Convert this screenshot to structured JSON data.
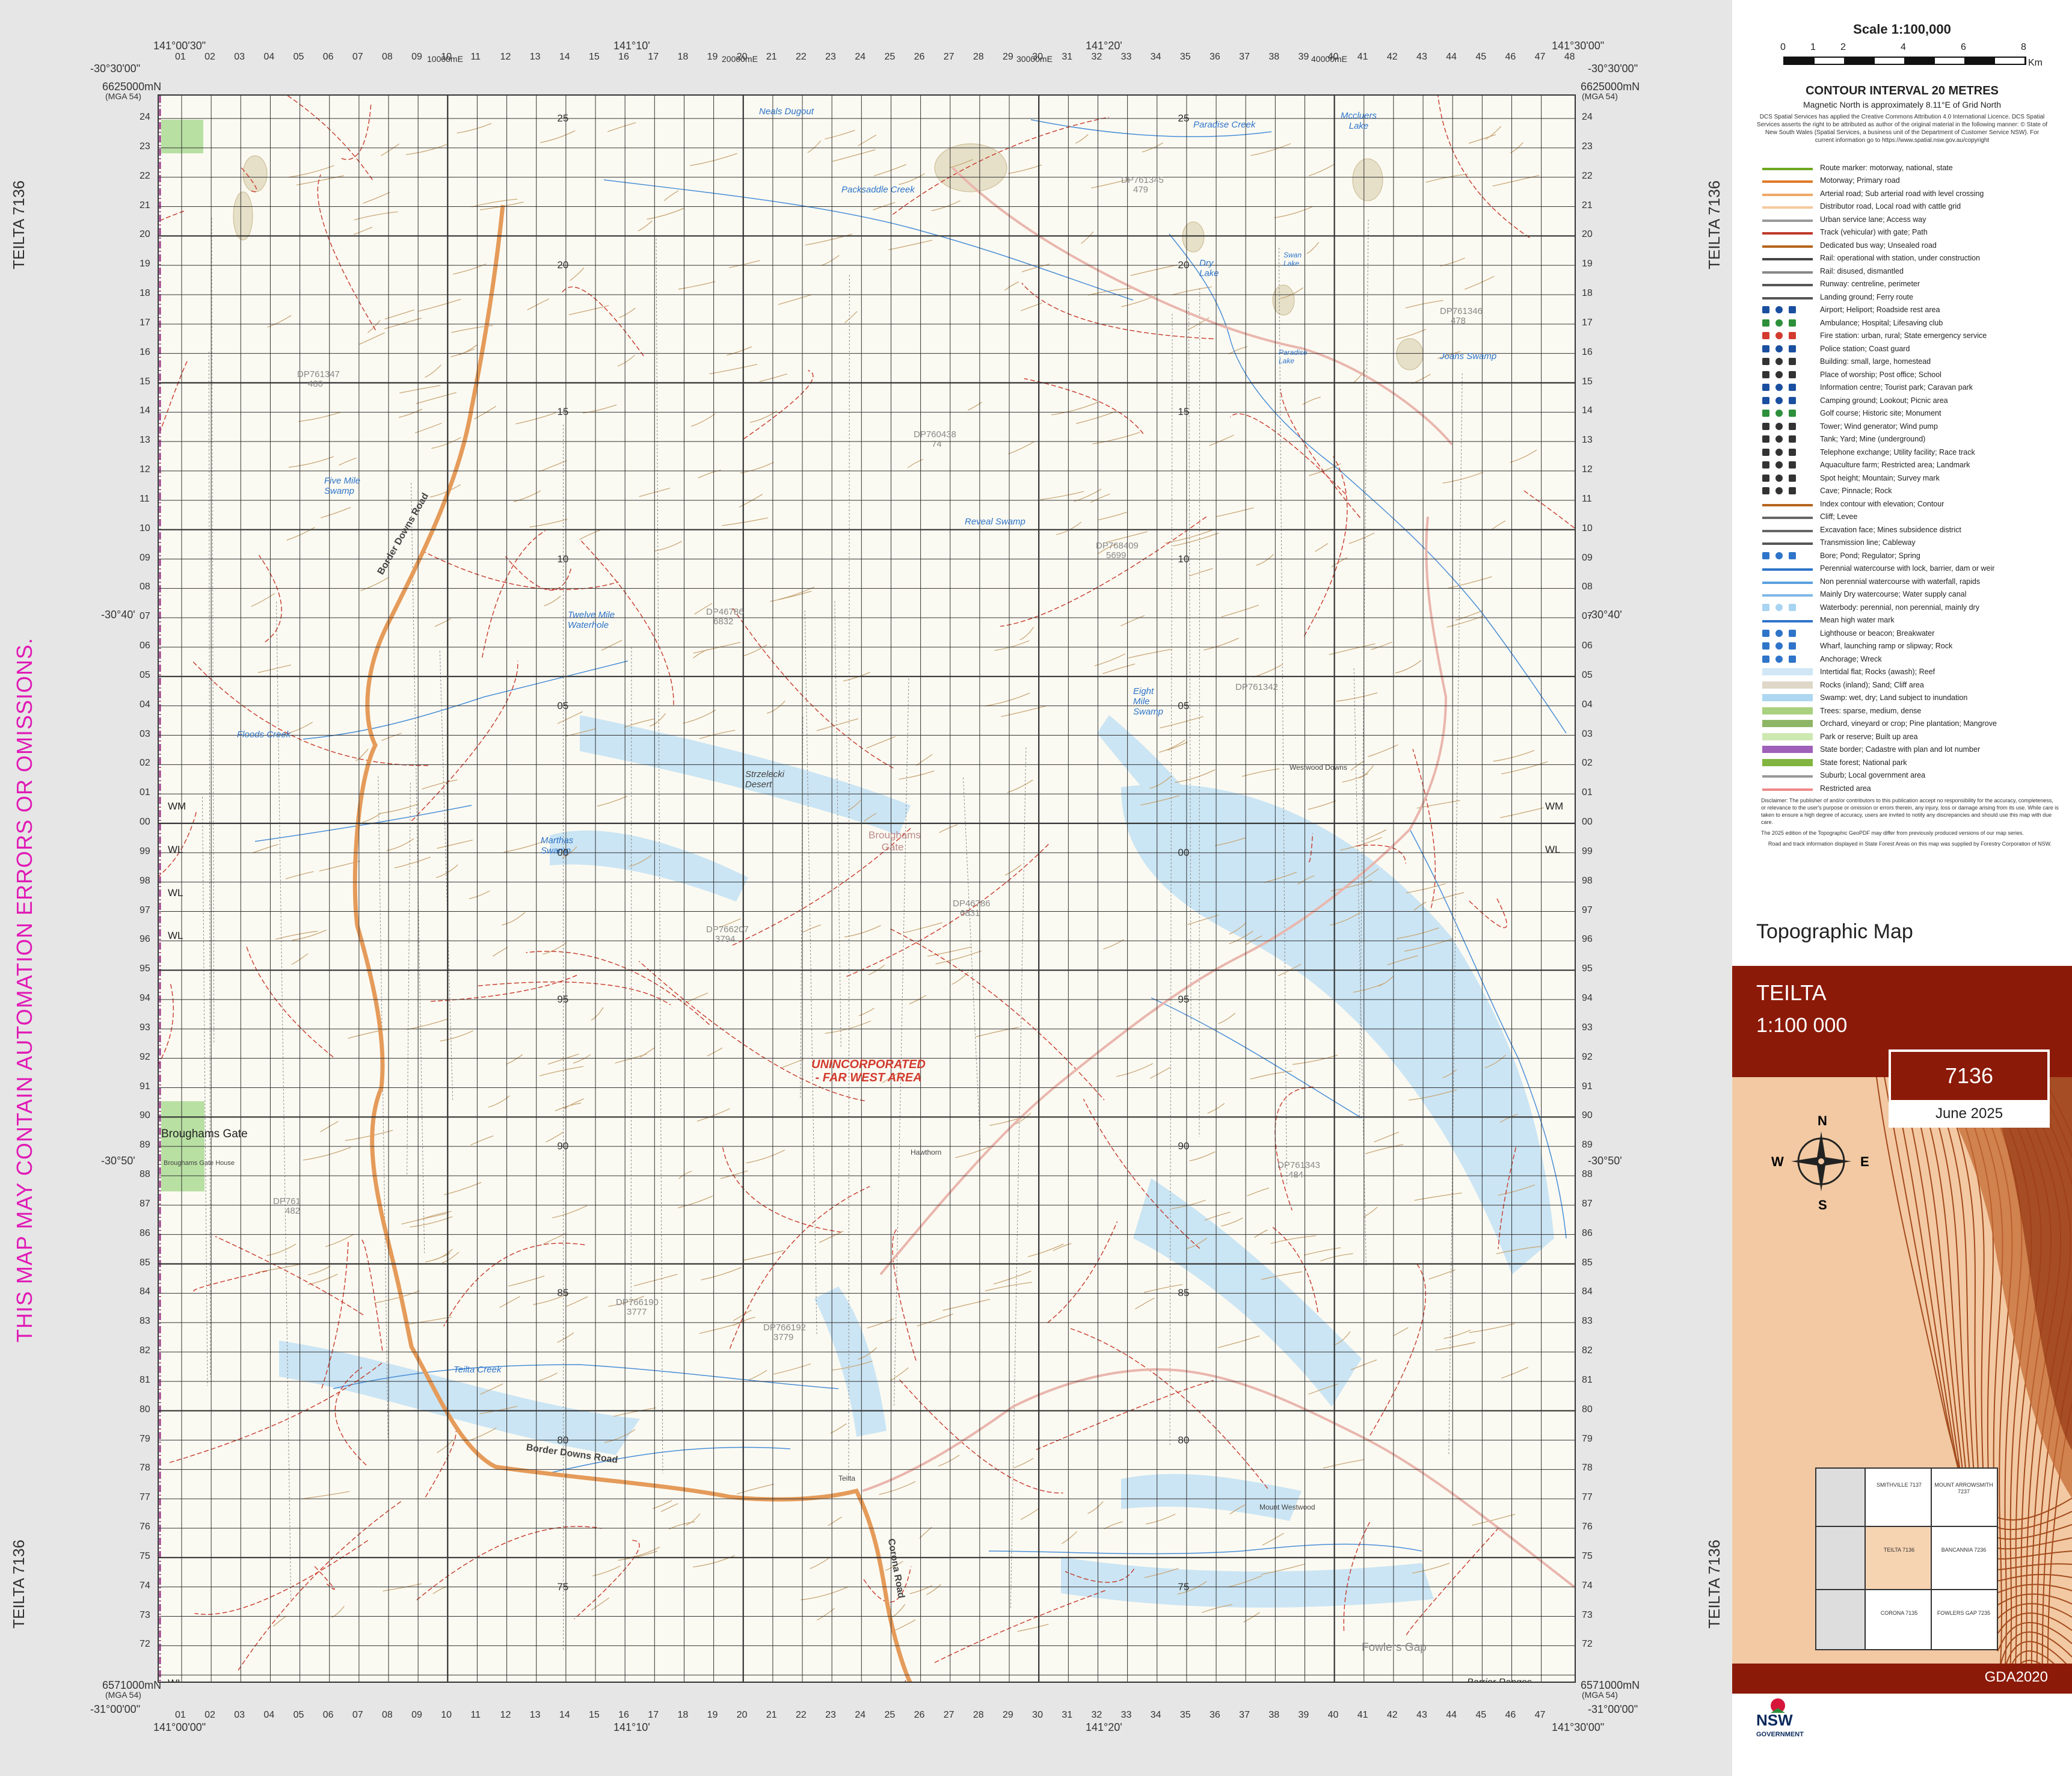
{
  "sheet": {
    "name": "TEILTA",
    "number": "7136",
    "side_label_top": "TEILTA 7136",
    "side_label_bottom": "TEILTA 7136",
    "warning": "THIS MAP MAY CONTAIN AUTOMATION ERRORS OR OMISSIONS."
  },
  "corners": {
    "top_left_lon": "141°00'30\"",
    "top_left_lat": "-30°30'00\"",
    "top_mid1_lon": "141°10'",
    "top_mid2_lon": "141°20'",
    "top_right_lon": "141°30'00\"",
    "top_right_lat": "-30°30'00\"",
    "bottom_left_lon": "141°00'00\"",
    "bottom_left_lat": "-31°00'00\"",
    "bottom_mid1_lon": "141°10'",
    "bottom_mid2_lon": "141°20'",
    "bottom_right_lon": "141°30'00\"",
    "bottom_right_lat": "-31°00'00\"",
    "lat_mid1_left": "-30°40'",
    "lat_mid1_right": "-30°40'",
    "lat_mid2_left": "-30°50'",
    "lat_mid2_right": "-30°50'",
    "northing_top_left": "6625000mN",
    "northing_top_right": "6625000mN",
    "mga_top": "(MGA 54)",
    "northing_bottom_left": "6571000mN",
    "northing_bottom_right": "6571000mN",
    "mga_bottom": "(MGA 54)",
    "easting_top_1": "10000mE",
    "easting_top_2": "20000mE",
    "easting_top_3": "30000mE",
    "easting_top_4": "40000mE"
  },
  "top_ticks": [
    "01",
    "02",
    "03",
    "04",
    "05",
    "06",
    "07",
    "08",
    "09",
    "10",
    "11",
    "12",
    "13",
    "14",
    "15",
    "16",
    "17",
    "18",
    "19",
    "20",
    "21",
    "22",
    "23",
    "24",
    "25",
    "26",
    "27",
    "28",
    "29",
    "30",
    "31",
    "32",
    "33",
    "34",
    "35",
    "36",
    "37",
    "38",
    "39",
    "40",
    "41",
    "42",
    "43",
    "44",
    "45",
    "46",
    "47",
    "48"
  ],
  "bottom_ticks": [
    "01",
    "02",
    "03",
    "04",
    "05",
    "06",
    "07",
    "08",
    "09",
    "10",
    "11",
    "12",
    "13",
    "14",
    "15",
    "16",
    "17",
    "18",
    "19",
    "20",
    "21",
    "22",
    "23",
    "24",
    "25",
    "26",
    "27",
    "28",
    "29",
    "30",
    "31",
    "32",
    "33",
    "34",
    "35",
    "36",
    "37",
    "38",
    "39",
    "40",
    "41",
    "42",
    "43",
    "44",
    "45",
    "46",
    "47"
  ],
  "side_ticks": [
    "24",
    "23",
    "22",
    "21",
    "20",
    "19",
    "18",
    "17",
    "16",
    "15",
    "14",
    "13",
    "12",
    "11",
    "10",
    "09",
    "08",
    "07",
    "06",
    "05",
    "04",
    "03",
    "02",
    "01",
    "00",
    "99",
    "98",
    "97",
    "96",
    "95",
    "94",
    "93",
    "92",
    "91",
    "90",
    "89",
    "88",
    "87",
    "86",
    "85",
    "84",
    "83",
    "82",
    "81",
    "80",
    "79",
    "78",
    "77",
    "76",
    "75",
    "74",
    "73",
    "72"
  ],
  "interior_labels": [
    "25",
    "20",
    "15",
    "10",
    "05",
    "00",
    "95",
    "90",
    "85",
    "80",
    "75"
  ],
  "places": {
    "neals_dugout": "Neals Dugout",
    "paradise_creek": "Paradise Creek",
    "mccluers_lake": "Mccluers Lake",
    "packsaddle_creek": "Packsaddle Creek",
    "dry_lake": "Dry Lake",
    "swan_lake": "Swan Lake",
    "paradise_lake": "Paradise Lake",
    "joans_swamp": "Joans Swamp",
    "five_mile_swamp": "Five Mile Swamp",
    "reveal_swamp": "Reveal Swamp",
    "twelve_mile_waterhole": "Twelve Mile Waterhole",
    "eight_mile_swamp": "Eight Mile Swamp",
    "floods_creek": "Floods Creek",
    "strzelecki_desert": "Strzelecki Desert",
    "westwood_downs": "Westwood Downs",
    "marthas_swamp": "Marthas Swamp",
    "broughams_gate_area": "Broughams Gate",
    "teilta_creek": "Teilta Creek",
    "border_downs_road_north": "Border Downs Road",
    "border_downs_road_south": "Border Downs Road",
    "broughams_gate": "Broughams Gate",
    "broughams_gate_house": "Broughams Gate House",
    "mount_westwood": "Mount Westwood",
    "fowlers_gap": "Fowlers Gap",
    "barrier_ranges": "Barrier Ranges",
    "corona_road": "Corona Road",
    "teilta": "Teilta",
    "hawthorn": "Hawthorn",
    "dp761345": "DP761345",
    "dp761345_n": "479",
    "dp761346": "DP761346",
    "dp761346_n": "478",
    "dp761347": "DP761347",
    "dp761347_n": "480",
    "dp760438": "DP760438",
    "dp760438_n": "74",
    "dp768409": "DP768409",
    "dp768409_n": "5699",
    "dp46786a": "DP46786",
    "dp46786a_n": "6832",
    "dp761342": "DP761342",
    "dp46786b": "DP46786",
    "dp46786b_n": "6831",
    "dp766207": "DP766207",
    "dp766207_n": "3794",
    "dp761343": "DP761343",
    "dp761343_n": "484",
    "dp761_482": "DP761",
    "dp761_482_n": "482",
    "dp766190": "DP766190",
    "dp766190_n": "3777",
    "dp766192": "DP766192",
    "dp766192_n": "3779",
    "wm_left": "WM",
    "wm_right": "WM",
    "wl_1": "WL",
    "wl_2": "WL",
    "wl_3": "WL",
    "wl_4": "WL",
    "wl_right": "WL"
  },
  "region_label": "UNINCORPORATED - FAR WEST AREA",
  "scale": {
    "title": "Scale 1:100,000",
    "marks": [
      "0",
      "1",
      "2",
      "4",
      "6",
      "8"
    ],
    "unit": "Km"
  },
  "contour": "CONTOUR INTERVAL 20 METRES",
  "magnetic": "Magnetic North is approximately 8.11°E of Grid North",
  "licence": "DCS Spatial Services has applied the Creative Commons Attribution 4.0 International Licence. DCS Spatial Services asserts the right to be attributed as author of the original material in the following manner: © State of New South Wales (Spatial Services, a business unit of the Department of Customer Service NSW). For current information go to https://www.spatial.nsw.gov.au/copyright",
  "legend": [
    {
      "label": "Route marker: motorway, national, state",
      "icon": "route-marker-icon",
      "color": "#6ca81f"
    },
    {
      "label": "Motorway; Primary road",
      "icon": "motorway-icon",
      "color": "#e07b28"
    },
    {
      "label": "Arterial road; Sub arterial road with level crossing",
      "icon": "arterial-road-icon",
      "color": "#f0a766"
    },
    {
      "label": "Distributor road, Local road with cattle grid",
      "icon": "distributor-road-icon",
      "color": "#f5c99d"
    },
    {
      "label": "Urban service lane; Access way",
      "icon": "service-lane-icon",
      "color": "#999999"
    },
    {
      "label": "Track (vehicular) with gate; Path",
      "icon": "track-icon",
      "color": "#c0392b"
    },
    {
      "label": "Dedicated bus way; Unsealed road",
      "icon": "busway-icon",
      "color": "#b5651d"
    },
    {
      "label": "Rail: operational with station, under construction",
      "icon": "rail-icon",
      "color": "#444444"
    },
    {
      "label": "Rail: disused, dismantled",
      "icon": "rail-disused-icon",
      "color": "#888888"
    },
    {
      "label": "Runway: centreline, perimeter",
      "icon": "runway-icon",
      "color": "#555555"
    },
    {
      "label": "Landing ground; Ferry route",
      "icon": "landing-ground-icon",
      "color": "#555555"
    },
    {
      "label": "Airport; Heliport; Roadside rest area",
      "icon": "airport-icon",
      "color": "#1a4fa0"
    },
    {
      "label": "Ambulance; Hospital; Lifesaving club",
      "icon": "ambulance-icon",
      "color": "#2d8f3a"
    },
    {
      "label": "Fire station: urban, rural; State emergency service",
      "icon": "fire-station-icon",
      "color": "#d23b2e"
    },
    {
      "label": "Police station; Coast guard",
      "icon": "police-icon",
      "color": "#1a4fa0"
    },
    {
      "label": "Building: small, large, homestead",
      "icon": "building-icon",
      "color": "#333333"
    },
    {
      "label": "Place of worship; Post office; School",
      "icon": "worship-icon",
      "color": "#333333"
    },
    {
      "label": "Information centre; Tourist park; Caravan park",
      "icon": "information-icon",
      "color": "#1a4fa0"
    },
    {
      "label": "Camping ground; Lookout; Picnic area",
      "icon": "camping-icon",
      "color": "#1a4fa0"
    },
    {
      "label": "Golf course; Historic site; Monument",
      "icon": "golf-icon",
      "color": "#2d8f3a"
    },
    {
      "label": "Tower; Wind generator; Wind pump",
      "icon": "tower-icon",
      "color": "#333333"
    },
    {
      "label": "Tank; Yard; Mine (underground)",
      "icon": "tank-icon",
      "color": "#333333"
    },
    {
      "label": "Telephone exchange; Utility facility; Race track",
      "icon": "telephone-icon",
      "color": "#333333"
    },
    {
      "label": "Aquaculture farm; Restricted area; Landmark",
      "icon": "aquaculture-icon",
      "color": "#333333"
    },
    {
      "label": "Spot height; Mountain; Survey mark",
      "icon": "spot-height-icon",
      "color": "#333333"
    },
    {
      "label": "Cave; Pinnacle; Rock",
      "icon": "cave-icon",
      "color": "#333333"
    },
    {
      "label": "Index contour with elevation; Contour",
      "icon": "contour-icon",
      "color": "#b5651d"
    },
    {
      "label": "Cliff; Levee",
      "icon": "cliff-icon",
      "color": "#666666"
    },
    {
      "label": "Excavation face; Mines subsidence district",
      "icon": "excavation-icon",
      "color": "#666666"
    },
    {
      "label": "Transmission line; Cableway",
      "icon": "transmission-icon",
      "color": "#555555"
    },
    {
      "label": "Bore; Pond; Regulator; Spring",
      "icon": "bore-icon",
      "color": "#2e74c9"
    },
    {
      "label": "Perennial watercourse with lock, barrier, dam or weir",
      "icon": "perennial-watercourse-icon",
      "color": "#2e74c9"
    },
    {
      "label": "Non perennial watercourse with waterfall, rapids",
      "icon": "non-perennial-icon",
      "color": "#5aa0e0"
    },
    {
      "label": "Mainly Dry watercourse; Water supply canal",
      "icon": "dry-watercourse-icon",
      "color": "#7fb7e8"
    },
    {
      "label": "Waterbody: perennial, non perennial, mainly dry",
      "icon": "waterbody-icon",
      "color": "#a8d4f2"
    },
    {
      "label": "Mean high water mark",
      "icon": "high-water-icon",
      "color": "#2e74c9"
    },
    {
      "label": "Lighthouse or beacon; Breakwater",
      "icon": "lighthouse-icon",
      "color": "#2e74c9"
    },
    {
      "label": "Wharf, launching ramp or slipway; Rock",
      "icon": "wharf-icon",
      "color": "#2e74c9"
    },
    {
      "label": "Anchorage; Wreck",
      "icon": "anchorage-icon",
      "color": "#2e74c9"
    },
    {
      "label": "Intertidal flat; Rocks (awash); Reef",
      "icon": "intertidal-icon",
      "color": "#c9e3f5"
    },
    {
      "label": "Rocks (inland); Sand; Cliff area",
      "icon": "rocks-icon",
      "color": "#d9d0bd"
    },
    {
      "label": "Swamp: wet, dry; Land subject to inundation",
      "icon": "swamp-icon",
      "color": "#9fd0ef"
    },
    {
      "label": "Trees: sparse, medium, dense",
      "icon": "trees-icon",
      "color": "#9bc968"
    },
    {
      "label": "Orchard, vineyard or crop; Pine plantation; Mangrove",
      "icon": "orchard-icon",
      "color": "#7aa84a"
    },
    {
      "label": "Park or reserve; Built up area",
      "icon": "park-icon",
      "color": "#c6e4a5"
    },
    {
      "label": "State border; Cadastre with plan and lot number",
      "icon": "state-border-icon",
      "color": "#8e44ad"
    },
    {
      "label": "State forest; National park",
      "icon": "state-forest-icon",
      "color": "#6ca81f"
    },
    {
      "label": "Suburb; Local government area",
      "icon": "suburb-icon",
      "color": "#999999"
    },
    {
      "label": "Restricted area",
      "icon": "restricted-area-icon",
      "color": "#e88"
    }
  ],
  "disclaimer": "Disclaimer: The publisher of and/or contributors to this publication accept no responsibility for the accuracy, completeness, or relevance to the user's purpose or omission or errors therein, any injury, loss or damage arising from its use. While care is taken to ensure a high degree of accuracy, users are invited to notify any discrepancies and should use this map with due care.",
  "edition_note": "The 2025 edition of the Topographic GeoPDF may differ from previously produced versions of our map series.",
  "forestry_note": "Road and track information displayed in State Forest Areas on this map was supplied by Forestry Corporation of NSW.",
  "cover": {
    "title": "Topographic Map",
    "name": "TEILTA",
    "scale": "1:100 000",
    "number": "7136",
    "date": "June 2025",
    "datum": "GDA2020",
    "compass": [
      "N",
      "S",
      "E",
      "W"
    ],
    "nsw": "NSW",
    "government": "GOVERNMENT"
  },
  "index_map": {
    "nw": "",
    "n": "SMITHVILLE 7137",
    "ne": "MOUNT ARROWSMITH 7237",
    "c": "TEILTA 7136",
    "e": "BANCANNIA 7236",
    "s": "CORONA 7135",
    "se": "FOWLERS GAP 7235"
  },
  "colors": {
    "road_primary": "#e59b5a",
    "track": "#c0392b",
    "water": "#2e74c9",
    "swamp": "#a8d4f2",
    "contour": "#c19a6b",
    "brand": "#8c1a09",
    "grid": "#222222"
  }
}
